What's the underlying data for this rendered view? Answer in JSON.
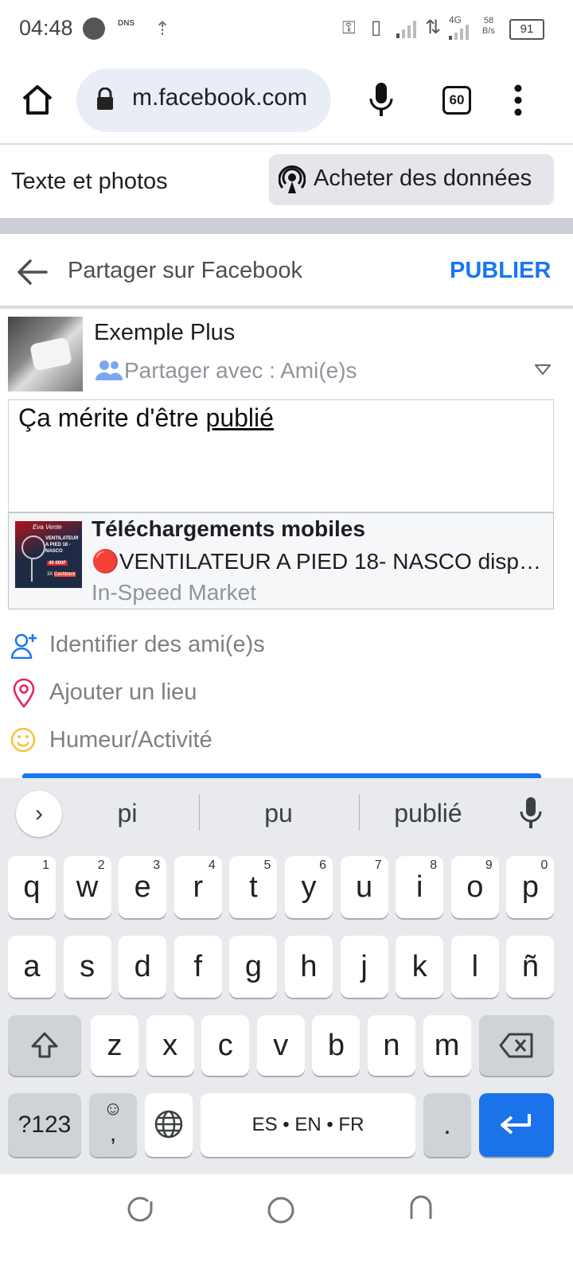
{
  "status_bar": {
    "time": "04:48",
    "dns_label": "DNS",
    "net_type": "4G",
    "speed_value": "58",
    "speed_unit": "B/s",
    "battery": "91"
  },
  "browser": {
    "url": "m.facebook.com",
    "tab_count": "60"
  },
  "topbar": {
    "mode_label": "Texte et photos",
    "buy_data_label": "Acheter des données"
  },
  "header": {
    "title": "Partager sur Facebook",
    "publish_label": "PUBLIER"
  },
  "composer": {
    "user_name": "Exemple Plus",
    "share_with": "Partager avec :  Ami(e)s",
    "text_before": "Ça mérite d'être ",
    "text_underlined": "publié"
  },
  "link_preview": {
    "title": "Téléchargements mobiles",
    "description": "🔴VENTILATEUR A PIED 18- NASCO disponible",
    "source": "In-Speed Market",
    "thumb_brand": "Eva Vente",
    "thumb_text": "VENTILATEUR A PIED 18 -NASCO",
    "thumb_price": "40 000F",
    "thumb_cashback_prefix": "3X",
    "thumb_cashback": "Cashback"
  },
  "actions": [
    {
      "label": "Identifier des ami(e)s",
      "icon": "add-friend-icon"
    },
    {
      "label": "Ajouter un lieu",
      "icon": "location-pin-icon"
    },
    {
      "label": "Humeur/Activité",
      "icon": "smiley-icon"
    }
  ],
  "keyboard": {
    "suggestions": [
      "pi",
      "pu",
      "publié"
    ],
    "row1": [
      {
        "k": "q",
        "h": "1"
      },
      {
        "k": "w",
        "h": "2"
      },
      {
        "k": "e",
        "h": "3"
      },
      {
        "k": "r",
        "h": "4"
      },
      {
        "k": "t",
        "h": "5"
      },
      {
        "k": "y",
        "h": "6"
      },
      {
        "k": "u",
        "h": "7"
      },
      {
        "k": "i",
        "h": "8"
      },
      {
        "k": "o",
        "h": "9"
      },
      {
        "k": "p",
        "h": "0"
      }
    ],
    "row2": [
      "a",
      "s",
      "d",
      "f",
      "g",
      "h",
      "j",
      "k",
      "l",
      "ñ"
    ],
    "row3": [
      "z",
      "x",
      "c",
      "v",
      "b",
      "n",
      "m"
    ],
    "symbols_key": "?123",
    "comma_key": ",",
    "space_label": "ES • EN • FR",
    "period_key": "."
  },
  "colors": {
    "accent": "#1877f2",
    "enter_key": "#1a73e8",
    "tag_icon": "#1877f2",
    "pin_icon": "#e0245e",
    "smiley_icon": "#f5c33b"
  }
}
